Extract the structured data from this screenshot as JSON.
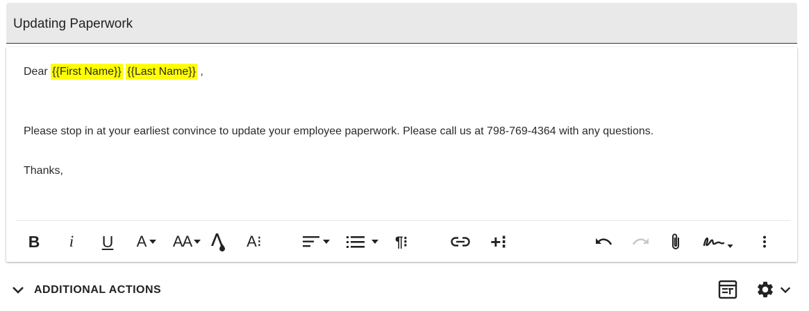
{
  "subject": {
    "text": "Updating Paperwork"
  },
  "message": {
    "greeting": "Dear",
    "token_first": "{{First Name}}",
    "token_last": "{{Last Name}}",
    "greeting_end": ",",
    "paragraph": "Please stop in at your earliest convince to update your employee paperwork. Please call us at 798-769-4364 with any questions.",
    "closing": "Thanks,"
  },
  "toolbar": {
    "bold": "B",
    "italic": "i",
    "underline": "U",
    "font": "A",
    "font_size": "AA",
    "more_text": "A⁝",
    "paragraph": "¶⁝",
    "insert": "+⁝",
    "more": "⋮",
    "icons": [
      "bold-icon",
      "italic-icon",
      "underline-icon",
      "font-color-icon",
      "font-size-icon",
      "highlight-color-icon",
      "more-text-icon",
      "align-icon",
      "list-icon",
      "paragraph-icon",
      "link-icon",
      "insert-icon",
      "undo-icon",
      "redo-icon",
      "attachment-icon",
      "signature-icon",
      "more-vertical-icon"
    ]
  },
  "actions": {
    "label": "ADDITIONAL ACTIONS",
    "icons": [
      "chevron-down-icon",
      "template-icon",
      "gear-icon",
      "chevron-down-icon"
    ]
  },
  "colors": {
    "highlight": "#ffff00",
    "subject_bg": "#e9e9e9",
    "disabled": "#c8c8c8"
  }
}
